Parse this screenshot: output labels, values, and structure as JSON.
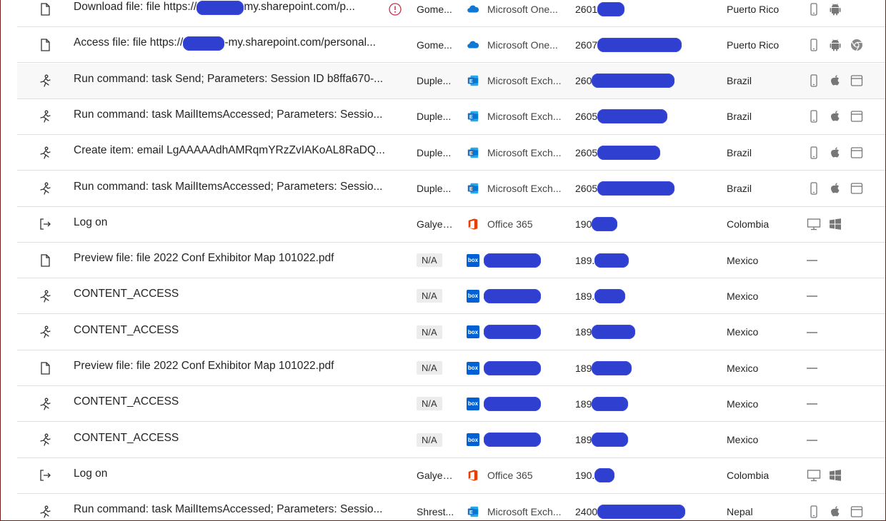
{
  "rows": [
    {
      "type": "file",
      "activity": "Download file: file https://",
      "activity_suffix": "my.sharepoint.com/p...",
      "alert": true,
      "user": "Gome...",
      "app_logo": "onedrive",
      "app": "Microsoft One...",
      "ip": "2601",
      "country": "Puerto Rico",
      "devices": [
        "phone-icon",
        "android-icon"
      ]
    },
    {
      "type": "file",
      "activity": "Access file: file https://",
      "activity_suffix": "-my.sharepoint.com/personal...",
      "alert": false,
      "user": "Gome...",
      "app_logo": "onedrive",
      "app": "Microsoft One...",
      "ip": "2607",
      "country": "Puerto Rico",
      "devices": [
        "phone-icon",
        "android-icon",
        "chrome-icon"
      ]
    },
    {
      "type": "run",
      "activity": "Run command: task Send; Parameters: Session ID b8ffa670-...",
      "activity_suffix": "",
      "alert": false,
      "user": "Duple...",
      "app_logo": "exchange",
      "app": "Microsoft Exch...",
      "ip": "260",
      "country": "Brazil",
      "devices": [
        "phone-icon",
        "apple-icon",
        "browser-icon"
      ],
      "highlight": true
    },
    {
      "type": "run",
      "activity": "Run command: task MailItemsAccessed; Parameters: Sessio...",
      "activity_suffix": "",
      "alert": false,
      "user": "Duple...",
      "app_logo": "exchange",
      "app": "Microsoft Exch...",
      "ip": "2605",
      "country": "Brazil",
      "devices": [
        "phone-icon",
        "apple-icon",
        "browser-icon"
      ]
    },
    {
      "type": "run",
      "activity": "Create item: email LgAAAAAdhAMRqmYRzZvIAKoAL8RaDQ...",
      "activity_suffix": "",
      "alert": false,
      "user": "Duple...",
      "app_logo": "exchange",
      "app": "Microsoft Exch...",
      "ip": "2605",
      "country": "Brazil",
      "devices": [
        "phone-icon",
        "apple-icon",
        "browser-icon"
      ]
    },
    {
      "type": "run",
      "activity": "Run command: task MailItemsAccessed; Parameters: Sessio...",
      "activity_suffix": "",
      "alert": false,
      "user": "Duple...",
      "app_logo": "exchange",
      "app": "Microsoft Exch...",
      "ip": "2605",
      "country": "Brazil",
      "devices": [
        "phone-icon",
        "apple-icon",
        "browser-icon"
      ]
    },
    {
      "type": "logon",
      "activity": "Log on",
      "activity_suffix": "",
      "alert": false,
      "user": "Galyea...",
      "app_logo": "office",
      "app": "Office 365",
      "ip": "190",
      "country": "Colombia",
      "devices": [
        "desktop-icon",
        "windows-icon"
      ]
    },
    {
      "type": "file",
      "activity": "Preview file: file 2022 Conf Exhibitor Map 101022.pdf",
      "activity_suffix": "",
      "alert": false,
      "user": "N/A",
      "user_badge": true,
      "app_logo": "box",
      "app": "",
      "ip": "189.",
      "country": "Mexico",
      "devices": [],
      "dash": "—"
    },
    {
      "type": "run",
      "activity": "CONTENT_ACCESS",
      "activity_suffix": "",
      "alert": false,
      "user": "N/A",
      "user_badge": true,
      "app_logo": "box",
      "app": "",
      "ip": "189.",
      "country": "Mexico",
      "devices": [],
      "dash": "—"
    },
    {
      "type": "run",
      "activity": "CONTENT_ACCESS",
      "activity_suffix": "",
      "alert": false,
      "user": "N/A",
      "user_badge": true,
      "app_logo": "box",
      "app": "",
      "ip": "189",
      "country": "Mexico",
      "devices": [],
      "dash": "—"
    },
    {
      "type": "file",
      "activity": "Preview file: file 2022 Conf Exhibitor Map 101022.pdf",
      "activity_suffix": "",
      "alert": false,
      "user": "N/A",
      "user_badge": true,
      "app_logo": "box",
      "app": "",
      "ip": "189",
      "country": "Mexico",
      "devices": [],
      "dash": "—"
    },
    {
      "type": "run",
      "activity": "CONTENT_ACCESS",
      "activity_suffix": "",
      "alert": false,
      "user": "N/A",
      "user_badge": true,
      "app_logo": "box",
      "app": "",
      "ip": "189",
      "country": "Mexico",
      "devices": [],
      "dash": "—"
    },
    {
      "type": "run",
      "activity": "CONTENT_ACCESS",
      "activity_suffix": "",
      "alert": false,
      "user": "N/A",
      "user_badge": true,
      "app_logo": "box",
      "app": "",
      "ip": "189",
      "country": "Mexico",
      "devices": [],
      "dash": "—"
    },
    {
      "type": "logon",
      "activity": "Log on",
      "activity_suffix": "",
      "alert": false,
      "user": "Galyea...",
      "app_logo": "office",
      "app": "Office 365",
      "ip": "190.",
      "country": "Colombia",
      "devices": [
        "desktop-icon",
        "windows-icon"
      ]
    },
    {
      "type": "run",
      "activity": "Run command: task MailItemsAccessed; Parameters: Sessio...",
      "activity_suffix": "",
      "alert": false,
      "user": "Shrest...",
      "app_logo": "exchange",
      "app": "Microsoft Exch...",
      "ip": "2400",
      "country": "Nepal",
      "devices": [
        "phone-icon",
        "apple-icon",
        "browser-icon"
      ]
    }
  ],
  "box_logo_text": "box",
  "colors": {
    "redaction": "#2f3fd0",
    "exchange": "#1d6fc4",
    "onedrive": "#0f78d4",
    "office": "#eb3c00",
    "box": "#0061d5",
    "alert": "#c4314b"
  }
}
